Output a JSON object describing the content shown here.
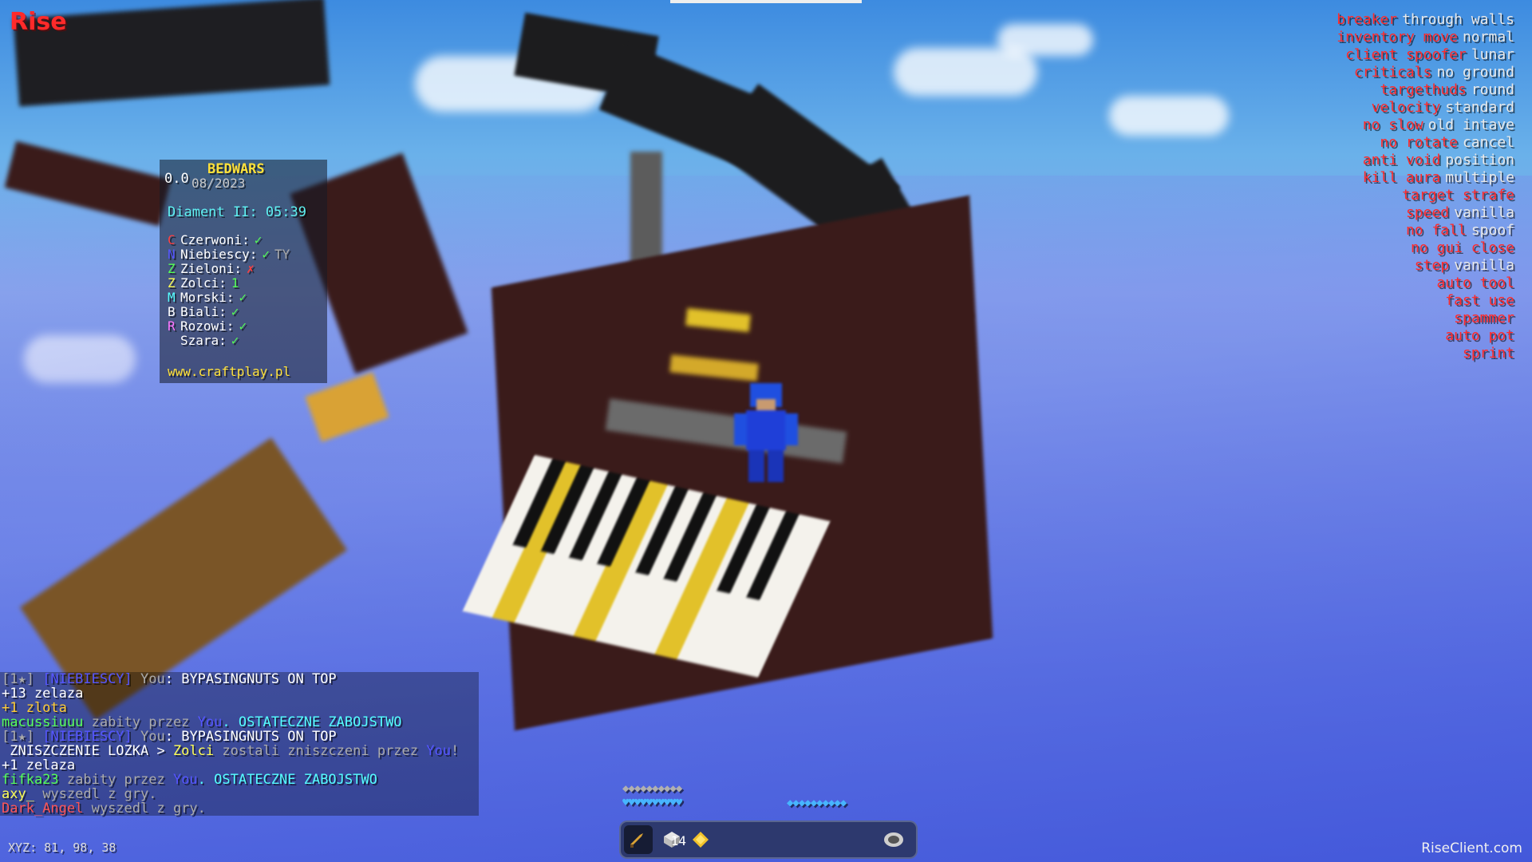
{
  "client": {
    "logo": "Rise",
    "watermark": "RiseClient.com",
    "coords": "XYZ: 81, 98, 38"
  },
  "scoreboard": {
    "fps": "0.0",
    "title": "BEDWARS",
    "date": "08/2023",
    "map": "Diament II: 05:39",
    "teams": [
      {
        "letter": "C",
        "letter_color": "#ff4040",
        "name": "Czerwoni:",
        "status": "✓",
        "status_color": "#55ff55",
        "extra": ""
      },
      {
        "letter": "N",
        "letter_color": "#5555ff",
        "name": "Niebiescy:",
        "status": "✓",
        "status_color": "#55ff55",
        "extra": "TY"
      },
      {
        "letter": "Z",
        "letter_color": "#55ff55",
        "name": "Zieloni:",
        "status": "✗",
        "status_color": "#ff4040",
        "extra": ""
      },
      {
        "letter": "Z",
        "letter_color": "#ffff55",
        "name": "Zolci:",
        "status": "1",
        "status_color": "#55ff55",
        "extra": ""
      },
      {
        "letter": "M",
        "letter_color": "#55ffff",
        "name": "Morski:",
        "status": "✓",
        "status_color": "#55ff55",
        "extra": ""
      },
      {
        "letter": "B",
        "letter_color": "#ffffff",
        "name": "Biali:",
        "status": "✓",
        "status_color": "#55ff55",
        "extra": ""
      },
      {
        "letter": "R",
        "letter_color": "#ff77ff",
        "name": "Rozowi:",
        "status": "✓",
        "status_color": "#55ff55",
        "extra": ""
      },
      {
        "letter": "",
        "letter_color": "#ffffff",
        "name": "Szara:",
        "status": "✓",
        "status_color": "#55ff55",
        "extra": ""
      }
    ],
    "site": "www.craftplay.pl"
  },
  "modules": [
    {
      "name": "breaker",
      "mode": "through walls"
    },
    {
      "name": "inventory move",
      "mode": "normal"
    },
    {
      "name": "client spoofer",
      "mode": "lunar"
    },
    {
      "name": "criticals",
      "mode": "no ground"
    },
    {
      "name": "targethuds",
      "mode": "round"
    },
    {
      "name": "velocity",
      "mode": "standard"
    },
    {
      "name": "no slow",
      "mode": "old intave"
    },
    {
      "name": "no rotate",
      "mode": "cancel"
    },
    {
      "name": "anti void",
      "mode": "position"
    },
    {
      "name": "kill aura",
      "mode": "multiple"
    },
    {
      "name": "target strafe",
      "mode": ""
    },
    {
      "name": "speed",
      "mode": "vanilla"
    },
    {
      "name": "no fall",
      "mode": "spoof"
    },
    {
      "name": "no gui close",
      "mode": ""
    },
    {
      "name": "step",
      "mode": "vanilla"
    },
    {
      "name": "auto tool",
      "mode": ""
    },
    {
      "name": "fast use",
      "mode": ""
    },
    {
      "name": "spammer",
      "mode": ""
    },
    {
      "name": "auto pot",
      "mode": ""
    },
    {
      "name": "sprint",
      "mode": ""
    }
  ],
  "chat": [
    [
      {
        "t": "[1★] ",
        "c": "#aaaaaa"
      },
      {
        "t": "[NIEBIESCY] ",
        "c": "#5555ff"
      },
      {
        "t": "You",
        "c": "#aaaaaa"
      },
      {
        "t": ": BYPASINGNUTS ON TOP",
        "c": "#ffffff"
      }
    ],
    [
      {
        "t": "+13 zelaza",
        "c": "#ffffff"
      }
    ],
    [
      {
        "t": "+1 zlota",
        "c": "#ffcc33"
      }
    ],
    [
      {
        "t": "macussiuuu",
        "c": "#55ff55"
      },
      {
        "t": " zabity przez ",
        "c": "#aaaaaa"
      },
      {
        "t": "You",
        "c": "#5555ff"
      },
      {
        "t": ". OSTATECZNE ZABOJSTWO",
        "c": "#55ffff"
      }
    ],
    [
      {
        "t": "[1★] ",
        "c": "#aaaaaa"
      },
      {
        "t": "[NIEBIESCY] ",
        "c": "#5555ff"
      },
      {
        "t": "You",
        "c": "#aaaaaa"
      },
      {
        "t": ": BYPASINGNUTS ON TOP",
        "c": "#ffffff"
      }
    ],
    [
      {
        "t": " ZNISZCZENIE LOZKA > ",
        "c": "#ffffff"
      },
      {
        "t": "Zolci",
        "c": "#ffff55"
      },
      {
        "t": " zostali zniszczeni przez ",
        "c": "#aaaaaa"
      },
      {
        "t": "You",
        "c": "#5555ff"
      },
      {
        "t": "!",
        "c": "#aaaaaa"
      }
    ],
    [
      {
        "t": "+1 zelaza",
        "c": "#ffffff"
      }
    ],
    [
      {
        "t": "fifka23",
        "c": "#55ff55"
      },
      {
        "t": " zabity przez ",
        "c": "#aaaaaa"
      },
      {
        "t": "You",
        "c": "#5555ff"
      },
      {
        "t": ". OSTATECZNE ZABOJSTWO",
        "c": "#55ffff"
      }
    ],
    [
      {
        "t": "axy_",
        "c": "#ffff55"
      },
      {
        "t": " wyszedl z gry.",
        "c": "#aaaaaa"
      }
    ],
    [
      {
        "t": "Dark_Angel",
        "c": "#ff5555"
      },
      {
        "t": " wyszedl z gry.",
        "c": "#aaaaaa"
      }
    ]
  ],
  "hud": {
    "armor": "◆◆◆◆◆◆◆◆◆◆",
    "hearts": "♥♥♥♥♥♥♥♥♥♥",
    "hunger": "◆◆◆◆◆◆◆◆◆◆",
    "hotbar_count": "14"
  },
  "icons": {
    "sword": "sword-icon",
    "blocks": "wool-block-icon",
    "gold": "gold-ingot-icon",
    "compass": "compass-icon"
  }
}
